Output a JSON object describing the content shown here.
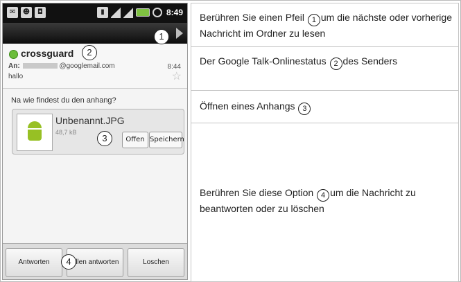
{
  "status_bar": {
    "left_icons": [
      "mail-icon",
      "contact-icon",
      "bag-icon"
    ],
    "right_icons": [
      "sim-icon",
      "signal-icon",
      "signal-icon",
      "battery-icon",
      "alarm-icon"
    ],
    "time": "8:49"
  },
  "email": {
    "sender": "crossguard",
    "to_label": "An:",
    "to_address": "@googlemail.com",
    "time": "8:44",
    "subject": "hallo",
    "body": "Na wie findest du den anhang?"
  },
  "attachment": {
    "name": "Unbenannt.JPG",
    "size": "48,7 kB",
    "open_label": "Offen",
    "save_label": "Speichern"
  },
  "bottom_bar": {
    "reply_label": "Antworten",
    "reply_all_label": "Allen antworten",
    "delete_label": "Loschen"
  },
  "callouts": [
    "1",
    "2",
    "3",
    "4"
  ],
  "rows": [
    {
      "text_before": "Berühren Sie einen Pfeil ",
      "callout": "1",
      "text_after": "um die nächste oder vorherige Nachricht im Ordner zu lesen"
    },
    {
      "text_before": "Der Google Talk-Onlinestatus ",
      "callout": "2",
      "text_after": "des Senders"
    },
    {
      "text_before": "Öffnen eines Anhangs ",
      "callout": "3",
      "text_after": ""
    },
    {
      "text_before": "Berühren Sie diese Option ",
      "callout": "4",
      "text_after": "um die Nachricht zu beantworten oder zu löschen"
    }
  ]
}
